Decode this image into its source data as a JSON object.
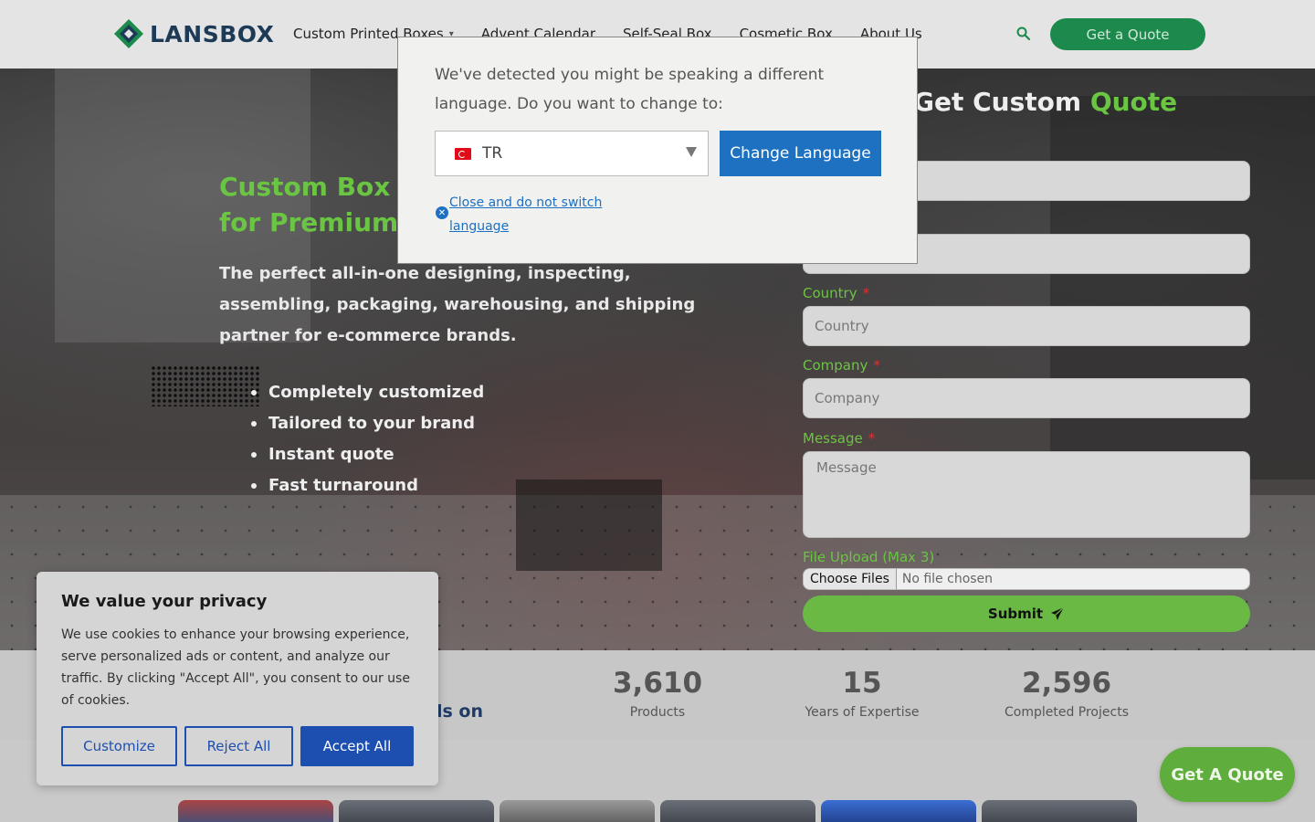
{
  "header": {
    "logo_text": "LANSBOX",
    "nav": [
      {
        "label": "Custom Printed Boxes",
        "has_dropdown": true
      },
      {
        "label": "Advent Calendar"
      },
      {
        "label": "Self-Seal Box"
      },
      {
        "label": "Cosmetic Box"
      },
      {
        "label": "About Us"
      }
    ],
    "quote_button": "Get a Quote",
    "colors": {
      "brand_green": "#1c8a4d",
      "brand_navy": "#1d3b57"
    }
  },
  "hero": {
    "title_line1": "Custom Box F",
    "title_line2": "for Premium",
    "subtitle": "The perfect all-in-one designing, inspecting, assembling, packaging, warehousing, and shipping partner for e-commerce brands.",
    "features": [
      "Completely customized",
      "Tailored to your brand",
      "Instant quote",
      "Fast turnaround"
    ]
  },
  "form": {
    "title_part1": "Get Custom",
    "title_part2": "Quote",
    "country_label": "Country",
    "country_placeholder": "Country",
    "company_label": "Company",
    "company_placeholder": "Company",
    "message_label": "Message",
    "message_placeholder": "Message",
    "required_mark": "*",
    "file_label": "File Upload (Max 3)",
    "file_button": "Choose Files",
    "file_status": "No file chosen",
    "submit": "Submit"
  },
  "stats": {
    "partial_text": "ls on",
    "items": [
      {
        "value": "3,610",
        "label": "Products"
      },
      {
        "value": "15",
        "label": "Years of Expertise"
      },
      {
        "value": "2,596",
        "label": "Completed Projects"
      }
    ]
  },
  "language_modal": {
    "message": "We've detected you might be speaking a different language. Do you want to change to:",
    "selected_code": "TR",
    "change_button": "Change Language",
    "close_link": "Close and do not switch language"
  },
  "cookie": {
    "title": "We value your privacy",
    "text": "We use cookies to enhance your browsing experience, serve personalized ads or content, and analyze our traffic. By clicking \"Accept All\", you consent to our use of cookies.",
    "customize": "Customize",
    "reject": "Reject All",
    "accept": "Accept All"
  },
  "floating_quote": "Get A Quote"
}
